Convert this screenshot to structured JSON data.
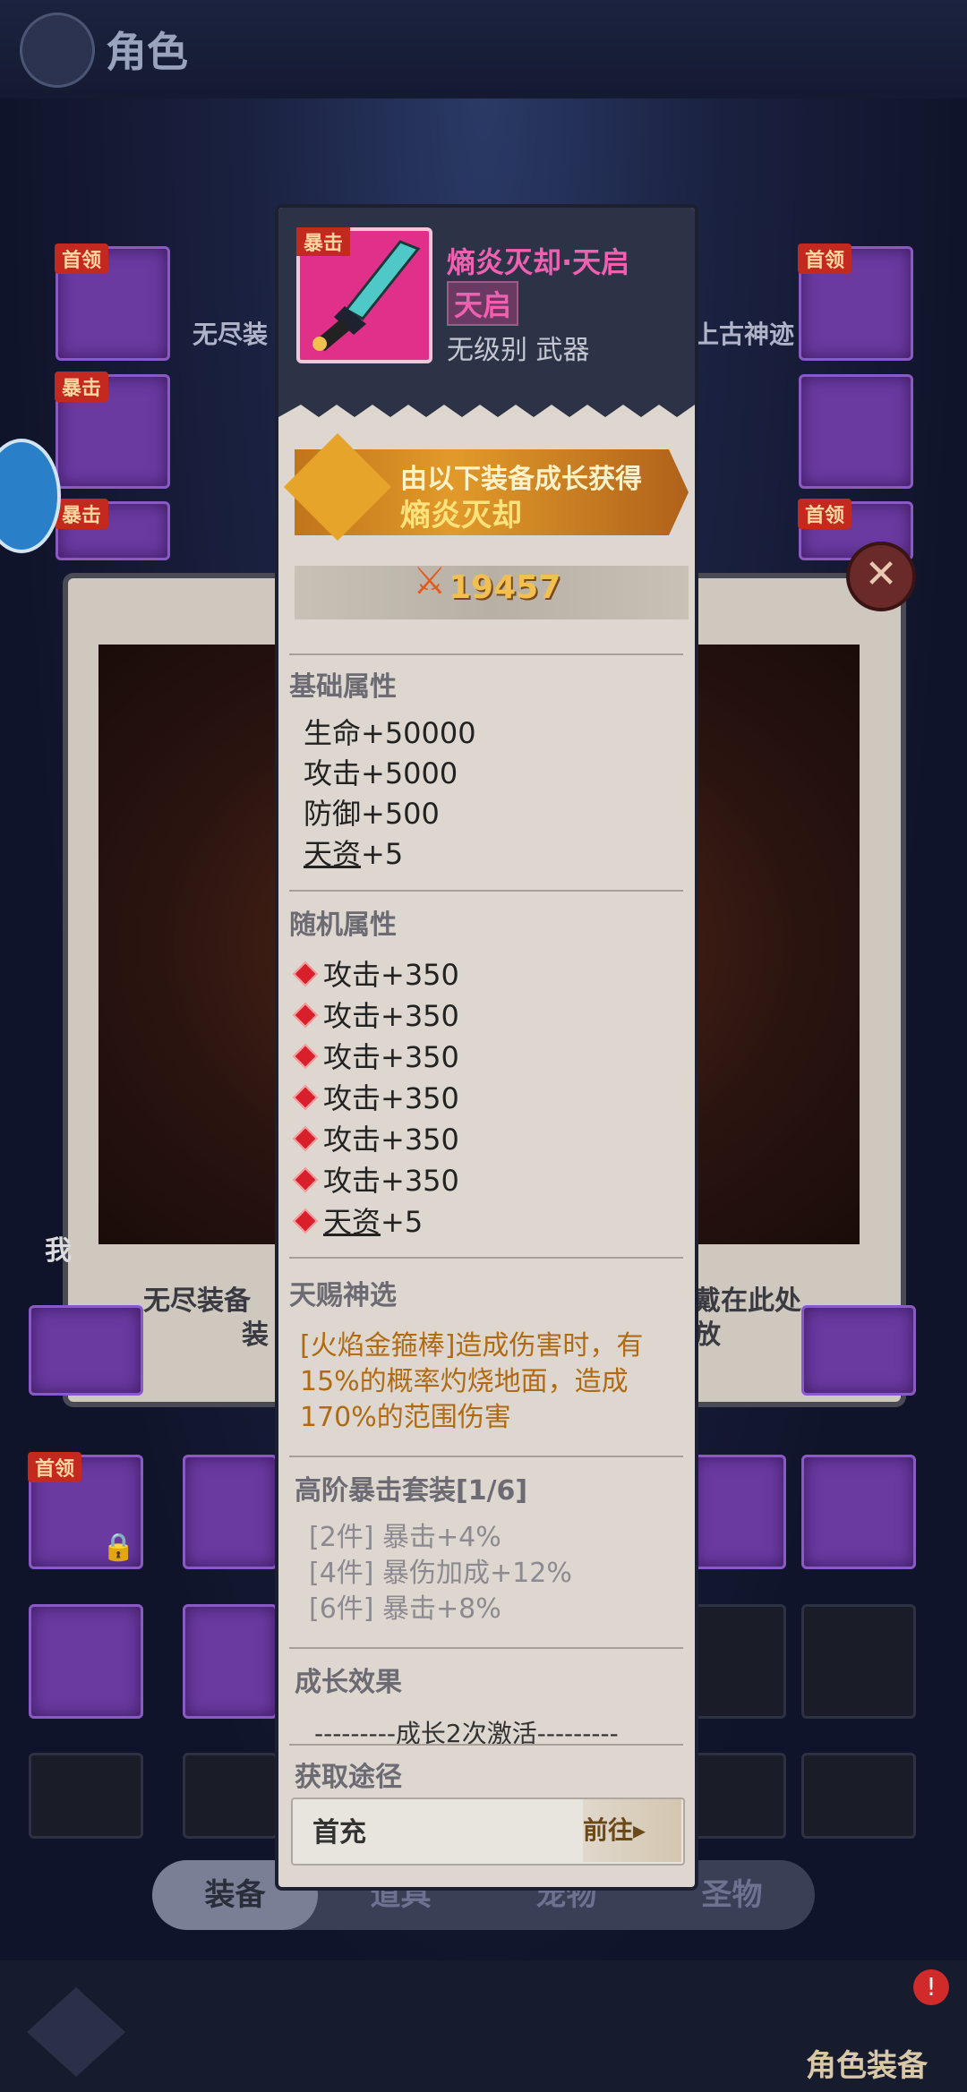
{
  "header": {
    "title": "角色"
  },
  "background": {
    "labels": [
      "无尽装",
      "上古神迹"
    ],
    "slot_tags": {
      "boss": "首领",
      "crit": "暴击"
    },
    "panel_text_left": "无尽装备",
    "panel_text_left2": "装",
    "panel_text_right": "戴在此处",
    "panel_text_right2": "放",
    "panel_partial_char": "我"
  },
  "tooltip": {
    "crit_tag": "暴击",
    "item_name": "熵炎灭却·天启",
    "item_tier": "天启",
    "item_type": "无级别 武器",
    "source_line1": "由以下装备成长获得",
    "source_line2": "熵炎灭却",
    "power": "19457",
    "base_title": "基础属性",
    "base_stats": [
      "生命+50000",
      "攻击+5000",
      "防御+500"
    ],
    "base_talent_label": "天资",
    "base_talent_value": "+5",
    "random_title": "随机属性",
    "random_stats": [
      "攻击+350",
      "攻击+350",
      "攻击+350",
      "攻击+350",
      "攻击+350",
      "攻击+350"
    ],
    "random_talent_label": "天资",
    "random_talent_value": "+5",
    "skill_title": "天赐神选",
    "skill_text": "[火焰金箍棒]造成伤害时，有15%的概率灼烧地面，造成170%的范围伤害",
    "set_title": "高阶暴击套装[1/6]",
    "set_lines": [
      "[2件] 暴击+4%",
      "[4件] 暴伤加成+12%",
      "[6件] 暴击+8%"
    ],
    "growth_title": "成长效果",
    "growth_line": "---------成长2次激活---------",
    "obtain_title": "获取途径",
    "obtain_item": "首充",
    "goto_label": "前往▸"
  },
  "bottom_tabs": [
    "装备",
    "道具",
    "宠物",
    "圣物"
  ],
  "role_equip": {
    "label": "角色装备",
    "badge": "!"
  },
  "close_glyph": "✕",
  "colors": {
    "accent_pink": "#f060b0",
    "gold": "#f2c050",
    "skill_text": "#b06a12",
    "epic_purple": "#6a3aa0"
  },
  "icons": [
    "role-icon",
    "sword-icon",
    "emblem-icon",
    "power-icon",
    "close-icon",
    "lock-icon",
    "monkey-avatar-icon"
  ]
}
